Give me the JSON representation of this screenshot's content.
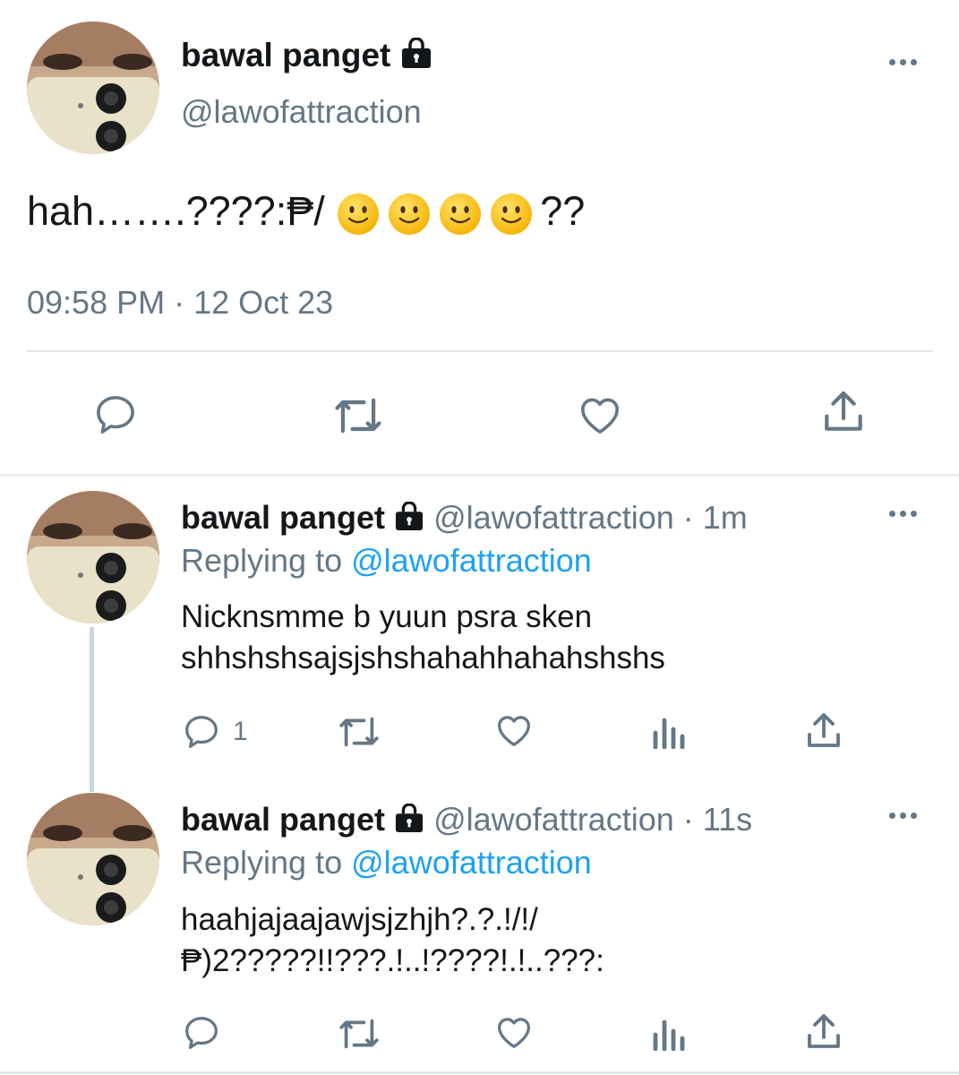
{
  "main_tweet": {
    "name": "bawal panget",
    "handle": "@lawofattraction",
    "text": "hah…….????:₱/ 🙂🙂🙂🙂??",
    "text_prefix": "hah…….????:₱/",
    "emoji_count": 4,
    "text_suffix": "??",
    "timestamp": "09:58 PM · 12 Oct 23",
    "actions": [
      "reply-icon",
      "retweet-icon",
      "like-icon",
      "share-icon"
    ]
  },
  "replies": [
    {
      "name": "bawal panget",
      "handle_time": "@lawofattraction · 1m",
      "replying_label": "Replying to",
      "replying_handle": "@lawofattraction",
      "line1": "Nicknsmme b yuun psra sken",
      "line2": "shhshshsajsjshshahahhahahshshs",
      "reply_count": "1"
    },
    {
      "name": "bawal panget",
      "handle_time": "@lawofattraction · 11s",
      "replying_label": "Replying to",
      "replying_handle": "@lawofattraction",
      "line1": "haahjajaajawjsjzhjh?.?.!/!/",
      "line2": "₱)2?????!!???.!..!????!.!..???:",
      "reply_count": ""
    }
  ],
  "colors": {
    "text": "#14171a",
    "secondary": "#657786",
    "link": "#1da1f2",
    "divider": "#e1e8ed"
  }
}
